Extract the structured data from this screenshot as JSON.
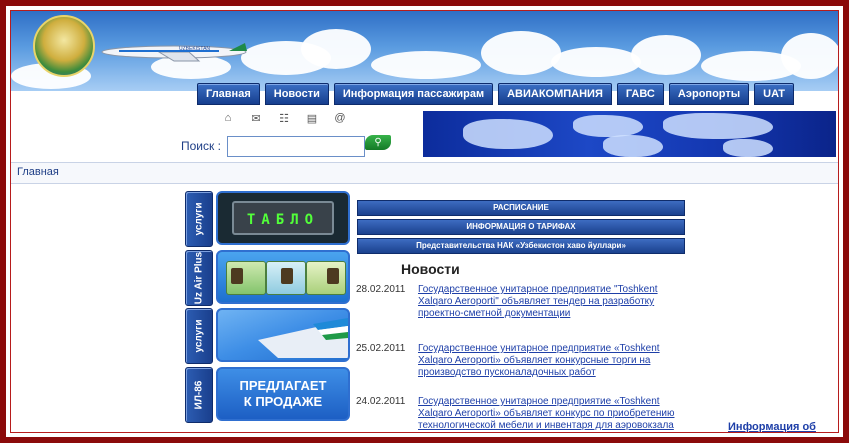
{
  "nav": {
    "tabs": [
      "Главная",
      "Новости",
      "Информация пассажирам",
      "АВИАКОМПАНИЯ",
      "ГАВС",
      "Аэропорты",
      "UAT"
    ]
  },
  "header": {
    "plane_label": "UZBEKISTAN"
  },
  "tools": {
    "icons": [
      "home-icon",
      "mail-icon",
      "sitemap-icon",
      "print-icon",
      "email-at-icon"
    ]
  },
  "search": {
    "label": "Поиск :",
    "value": "",
    "button_icon": "search-icon"
  },
  "breadcrumb": {
    "label": "Главная"
  },
  "sidebar": {
    "tabs": [
      "услуги",
      "Uz Air Plus",
      "услуги",
      "ИЛ-86"
    ],
    "tablo_text": "ТАБЛО",
    "sell_text": [
      "ПРЕДЛАГАЕТ",
      "К ПРОДАЖЕ"
    ]
  },
  "main": {
    "buttons": [
      "РАСПИСАНИЕ",
      "ИНФОРМАЦИЯ О ТАРИФАХ",
      "Представительства НАК «Узбекистон хаво йуллари»"
    ],
    "news_heading": "Новости",
    "news": [
      {
        "date": "28.02.2011",
        "text": "Государственное унитарное предприятие \"Toshkent Xalqaro Aeroporti\" объявляет тендер на разработку проектно-сметной документации"
      },
      {
        "date": "25.02.2011",
        "text": "Государственное унитарное предприятие «Toshkent Xalqaro Aeroporti» объявляет конкурсные торги на производство пусконаладочных работ"
      },
      {
        "date": "24.02.2011",
        "text": "Государственное унитарное предприятие «Toshkent Xalqaro Aeroporti» объявляет конкурс по приобретению технологической мебели и инвентаря для аэровокзала местных линий"
      }
    ],
    "ebilet_link": "Информация об электронном билете"
  },
  "colors": {
    "frame": "#8b0a0a",
    "nav_tab": "#1f4a9c",
    "link": "#1e3fa8",
    "tablo_text": "#52ff3a"
  }
}
